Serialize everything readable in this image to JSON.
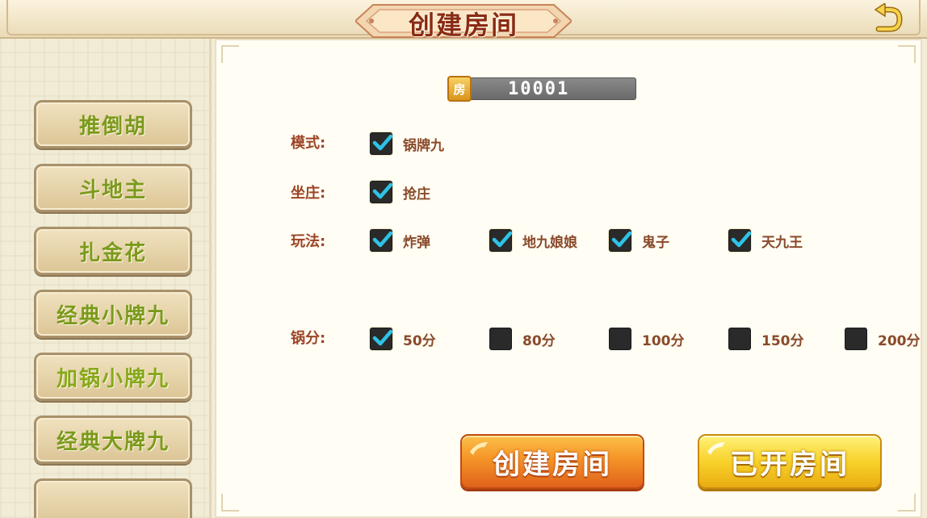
{
  "header": {
    "title": "创建房间",
    "back_icon": "back-arrow-icon"
  },
  "sidebar": {
    "items": [
      {
        "label": "推倒胡"
      },
      {
        "label": "斗地主"
      },
      {
        "label": "扎金花"
      },
      {
        "label": "经典小牌九"
      },
      {
        "label": "加锅小牌九"
      },
      {
        "label": "经典大牌九"
      },
      {
        "label": ""
      }
    ]
  },
  "room": {
    "icon_label": "房",
    "number": "10001"
  },
  "options": {
    "mode": {
      "label": "模式:",
      "choices": [
        {
          "label": "锅牌九",
          "checked": true
        }
      ]
    },
    "banker": {
      "label": "坐庄:",
      "choices": [
        {
          "label": "抢庄",
          "checked": true
        }
      ]
    },
    "rules": {
      "label": "玩法:",
      "choices": [
        {
          "label": "炸弹",
          "checked": true
        },
        {
          "label": "地九娘娘",
          "checked": true
        },
        {
          "label": "鬼子",
          "checked": true
        },
        {
          "label": "天九王",
          "checked": true
        }
      ]
    },
    "pot": {
      "label": "锅分:",
      "choices": [
        {
          "label": "50分",
          "checked": true
        },
        {
          "label": "80分",
          "checked": false
        },
        {
          "label": "100分",
          "checked": false
        },
        {
          "label": "150分",
          "checked": false
        },
        {
          "label": "200分",
          "checked": false
        }
      ]
    }
  },
  "actions": {
    "create_label": "创建房间",
    "opened_label": "已开房间"
  },
  "colors": {
    "label_brown": "#9c4526",
    "sidebar_text_green": "#7a9a1c",
    "check_cyan": "#2ec3e6",
    "create_orange": "#f59428",
    "opened_yellow": "#f8d22a"
  }
}
